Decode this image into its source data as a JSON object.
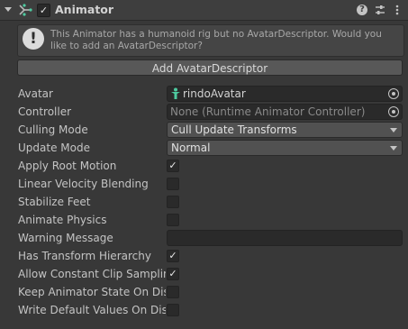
{
  "header": {
    "title": "Animator",
    "enabled_mark": "✓",
    "help_glyph": "?",
    "icons": [
      "fold-arrow-icon",
      "animator-component-icon",
      "help-icon",
      "presets-icon",
      "menu-icon"
    ]
  },
  "helpbox": {
    "icon": "!",
    "text": "This Animator has a humanoid rig but no AvatarDescriptor. Would you like to add an AvatarDescriptor?"
  },
  "add_button": {
    "label": "Add AvatarDescriptor"
  },
  "properties": {
    "avatar": {
      "label": "Avatar",
      "value": "rindoAvatar"
    },
    "controller": {
      "label": "Controller",
      "value": "None (Runtime Animator Controller)"
    },
    "culling_mode": {
      "label": "Culling Mode",
      "value": "Cull Update Transforms"
    },
    "update_mode": {
      "label": "Update Mode",
      "value": "Normal"
    },
    "apply_root_motion": {
      "label": "Apply Root Motion",
      "mark": "✓"
    },
    "linear_velocity_blending": {
      "label": "Linear Velocity Blending",
      "mark": ""
    },
    "stabilize_feet": {
      "label": "Stabilize Feet",
      "mark": ""
    },
    "animate_physics": {
      "label": "Animate Physics",
      "mark": ""
    },
    "warning_message": {
      "label": "Warning Message",
      "value": ""
    },
    "has_transform_hierarchy": {
      "label": "Has Transform Hierarchy",
      "mark": "✓"
    },
    "allow_constant_clip_sampling": {
      "label": "Allow Constant Clip Sampling",
      "mark": "✓"
    },
    "keep_animator_state": {
      "label": "Keep Animator State On Disa",
      "mark": ""
    },
    "write_default_values": {
      "label": "Write Default Values On Disal",
      "mark": ""
    }
  },
  "colors": {
    "background": "#383838",
    "header": "#3e3e3e",
    "field": "#2a2a2a",
    "button": "#585858",
    "avatar_icon": "#4ecba0"
  }
}
